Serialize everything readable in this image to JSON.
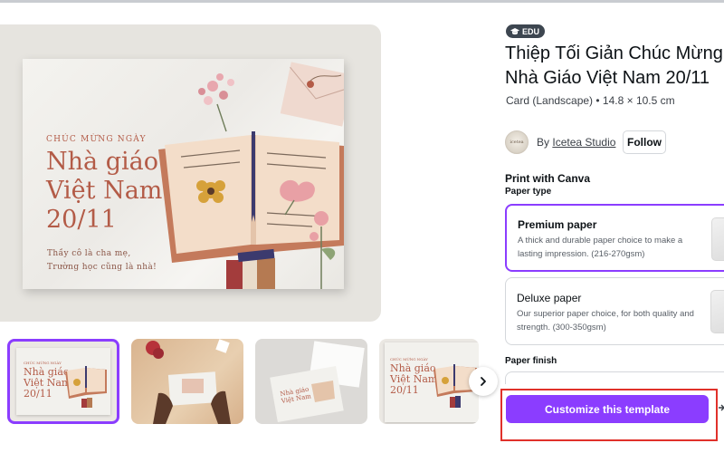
{
  "preview": {
    "card": {
      "kicker": "CHÚC MỪNG NGÀY",
      "title_line1": "Nhà giáo",
      "title_line2": "Việt Nam",
      "title_line3": "20/11",
      "tagline_line1": "Thầy cô là cha mẹ,",
      "tagline_line2": "Trường học cũng là nhà!"
    },
    "thumbnails": [
      {
        "name": "card-front",
        "selected": true
      },
      {
        "name": "hands-holding-card",
        "selected": false
      },
      {
        "name": "card-with-envelope",
        "selected": false
      },
      {
        "name": "card-front-copy",
        "selected": false
      }
    ],
    "mini_card": {
      "kicker": "CHÚC MỪNG NGÀY",
      "line1": "Nhà giáo",
      "line2": "Việt Nam",
      "line3": "20/11"
    }
  },
  "product": {
    "badge": "EDU",
    "title_line1": "Thiệp Tối Giản Chúc Mừng N",
    "title_line2": "Nhà Giáo Việt Nam 20/11",
    "meta": "Card (Landscape) • 14.8 × 10.5 cm",
    "creator": {
      "by": "By",
      "name": "Icetea Studio",
      "avatar_text": "icetea",
      "follow": "Follow"
    },
    "print": {
      "heading": "Print with Canva",
      "paper_type_label": "Paper type",
      "options": [
        {
          "name": "Premium paper",
          "desc": "A thick and durable paper choice to make a lasting impression. (216-270gsm)",
          "selected": true
        },
        {
          "name": "Deluxe paper",
          "desc": "Our superior paper choice, for both quality and strength. (300-350gsm)",
          "selected": false
        }
      ],
      "finish_label": "Paper finish"
    },
    "cta": "Customize this template"
  },
  "colors": {
    "accent": "#8b3dff",
    "highlight": "#e0312a",
    "card_text": "#b35b47"
  }
}
